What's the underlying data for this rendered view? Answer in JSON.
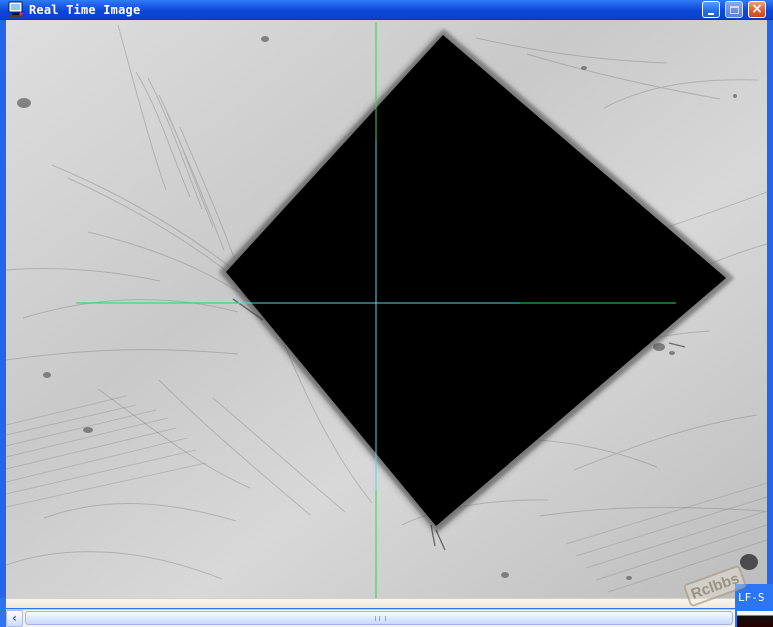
{
  "window": {
    "title": "Real Time Image",
    "controls": {
      "minimize_icon": "minimize-icon",
      "maximize_icon": "maximize-icon",
      "close_icon": "close-icon"
    }
  },
  "colors": {
    "title_bar": "#1f5fe6",
    "crosshair_green": "#2bd84f",
    "crosshair_cyan": "#6bd0ff",
    "sample_background": "#cfcfcf",
    "indentation": "#000000",
    "close_button": "#df5f34"
  },
  "status": {
    "corner_text": "LF-S"
  },
  "watermark": {
    "text": "Rclbbs"
  },
  "scrollbar": {
    "left_arrow": "‹",
    "thumb_icon": "scroll-grip-icon"
  }
}
